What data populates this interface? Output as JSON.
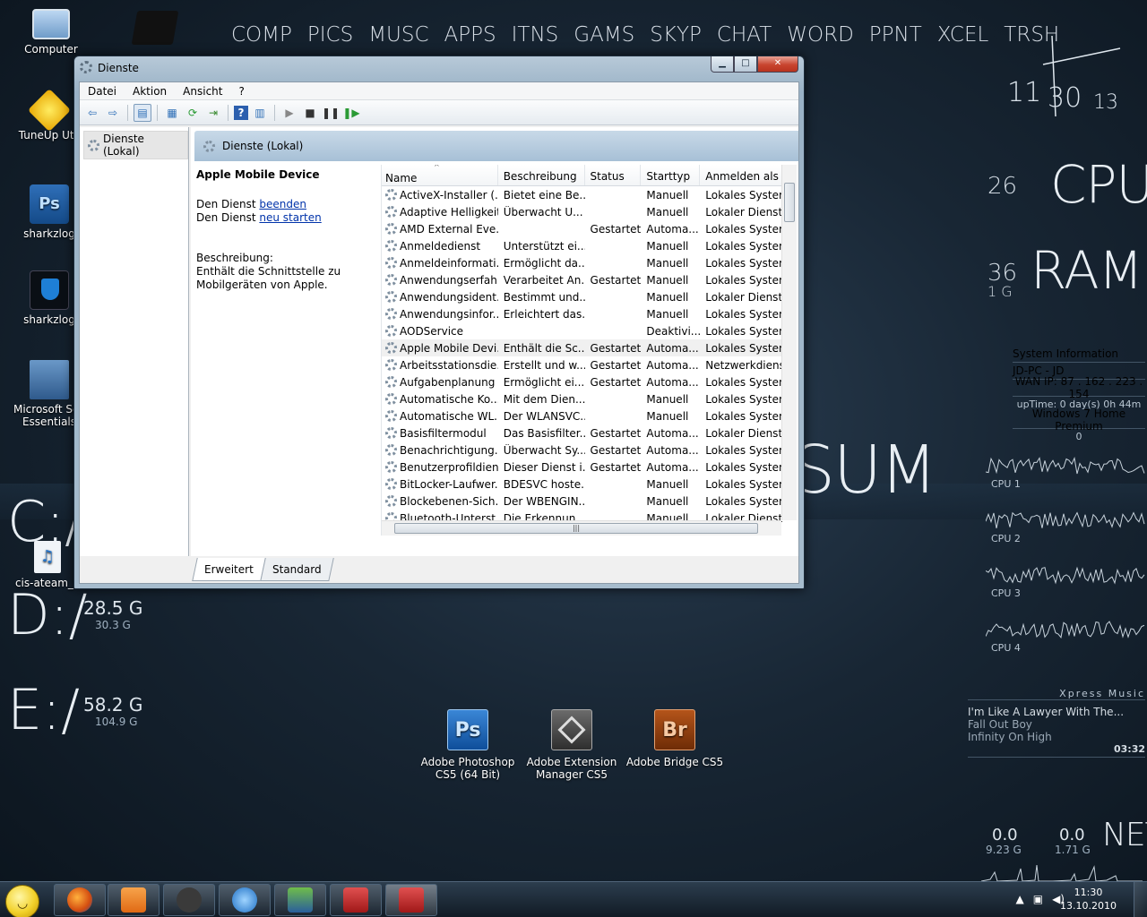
{
  "launcher": [
    "COMP",
    "PICS",
    "MUSC",
    "APPS",
    "ITNS",
    "GAMS",
    "SKYP",
    "CHAT",
    "WORD",
    "PPNT",
    "XCEL",
    "TRSH"
  ],
  "desktop_icons": {
    "computer": "Computer",
    "tuneup": "TuneUp Util",
    "psd": "sharkzlog",
    "sharkz2": "sharkzlog",
    "mse_line1": "Microsoft Sec",
    "mse_line2": "Essentials",
    "cis": "cis-ateam_x",
    "photoshop_line1": "Adobe Photoshop",
    "photoshop_line2": "CS5 (64 Bit)",
    "extmgr_line1": "Adobe Extension",
    "extmgr_line2": "Manager CS5",
    "bridge": "Adobe Bridge CS5"
  },
  "clock": {
    "hour": "11",
    "minute": "30",
    "second": "13"
  },
  "stats": {
    "cpu_value": "26",
    "cpu_label": "CPU",
    "ram_value": "36",
    "ram_sub": "1 G",
    "ram_label": "RAM",
    "sum_label": "SUM"
  },
  "sysinfo": {
    "title": "System Information",
    "host": "JD-PC - JD",
    "wan": "WAN IP: 87 . 162 . 223 . 154",
    "uptime": "upTime: 0 day(s) 0h 44m",
    "os": "Windows 7 Home Premium",
    "zero": "0"
  },
  "cpus": [
    "CPU 1",
    "CPU 2",
    "CPU 3",
    "CPU 4"
  ],
  "drives": [
    {
      "letter": "C:/",
      "big": "",
      "small": ""
    },
    {
      "letter": "D:/",
      "big": "28.5 G",
      "small": "30.3 G"
    },
    {
      "letter": "E:/",
      "big": "58.2 G",
      "small": "104.9 G"
    }
  ],
  "music": {
    "header": "Xpress Music",
    "track": "I'm Like A Lawyer With The...",
    "artist": "Fall Out Boy",
    "album": "Infinity On High",
    "time": "03:32"
  },
  "net": {
    "down": "0.0",
    "down_total": "9.23 G",
    "up": "0.0",
    "up_total": "1.71 G",
    "label": "NET"
  },
  "window": {
    "title": "Dienste",
    "menu": [
      "Datei",
      "Aktion",
      "Ansicht",
      "?"
    ],
    "tree_node": "Dienste (Lokal)",
    "panel_header": "Dienste (Lokal)",
    "detail_title": "Apple Mobile Device",
    "stop_prefix": "Den Dienst",
    "stop_link": "beenden",
    "restart_prefix": "Den Dienst",
    "restart_link": "neu starten",
    "desc_label": "Beschreibung:",
    "desc_text": "Enthält die Schnittstelle zu Mobilgeräten von Apple.",
    "columns": [
      "Name",
      "Beschreibung",
      "Status",
      "Starttyp",
      "Anmelden als"
    ],
    "rows": [
      [
        "ActiveX-Installer (...",
        "Bietet eine Be...",
        "",
        "Manuell",
        "Lokales System"
      ],
      [
        "Adaptive Helligkeit",
        "Überwacht U...",
        "",
        "Manuell",
        "Lokaler Dienst"
      ],
      [
        "AMD External Eve...",
        "",
        "Gestartet",
        "Automa...",
        "Lokales System"
      ],
      [
        "Anmeldedienst",
        "Unterstützt ei...",
        "",
        "Manuell",
        "Lokales System"
      ],
      [
        "Anmeldeinformati...",
        "Ermöglicht da...",
        "",
        "Manuell",
        "Lokales System"
      ],
      [
        "Anwendungserfah...",
        "Verarbeitet An...",
        "Gestartet",
        "Manuell",
        "Lokales System"
      ],
      [
        "Anwendungsident...",
        "Bestimmt und...",
        "",
        "Manuell",
        "Lokaler Dienst"
      ],
      [
        "Anwendungsinfor...",
        "Erleichtert das...",
        "",
        "Manuell",
        "Lokales System"
      ],
      [
        "AODService",
        "",
        "",
        "Deaktivi...",
        "Lokales System"
      ],
      [
        "Apple Mobile Devi...",
        "Enthält die Sc...",
        "Gestartet",
        "Automa...",
        "Lokales System"
      ],
      [
        "Arbeitsstationsdie...",
        "Erstellt und w...",
        "Gestartet",
        "Automa...",
        "Netzwerkdienst"
      ],
      [
        "Aufgabenplanung",
        "Ermöglicht ei...",
        "Gestartet",
        "Automa...",
        "Lokales System"
      ],
      [
        "Automatische Ko...",
        "Mit dem Dien...",
        "",
        "Manuell",
        "Lokales System"
      ],
      [
        "Automatische WL...",
        "Der WLANSVC...",
        "",
        "Manuell",
        "Lokales System"
      ],
      [
        "Basisfiltermodul",
        "Das Basisfilter...",
        "Gestartet",
        "Automa...",
        "Lokaler Dienst"
      ],
      [
        "Benachrichtigung...",
        "Überwacht Sy...",
        "Gestartet",
        "Automa...",
        "Lokales System"
      ],
      [
        "Benutzerprofildienst",
        "Dieser Dienst i...",
        "Gestartet",
        "Automa...",
        "Lokales System"
      ],
      [
        "BitLocker-Laufwer...",
        "BDESVC hoste...",
        "",
        "Manuell",
        "Lokales System"
      ],
      [
        "Blockebenen-Sich...",
        "Der WBENGIN...",
        "",
        "Manuell",
        "Lokales System"
      ],
      [
        "Bluetooth-Unterst...",
        "Die Erkennun...",
        "",
        "Manuell",
        "Lokaler Dienst"
      ]
    ],
    "selected_row": 9,
    "tabs": [
      "Erweitert",
      "Standard"
    ]
  },
  "taskbar": {
    "time": "11:30",
    "date": "13.10.2010"
  }
}
